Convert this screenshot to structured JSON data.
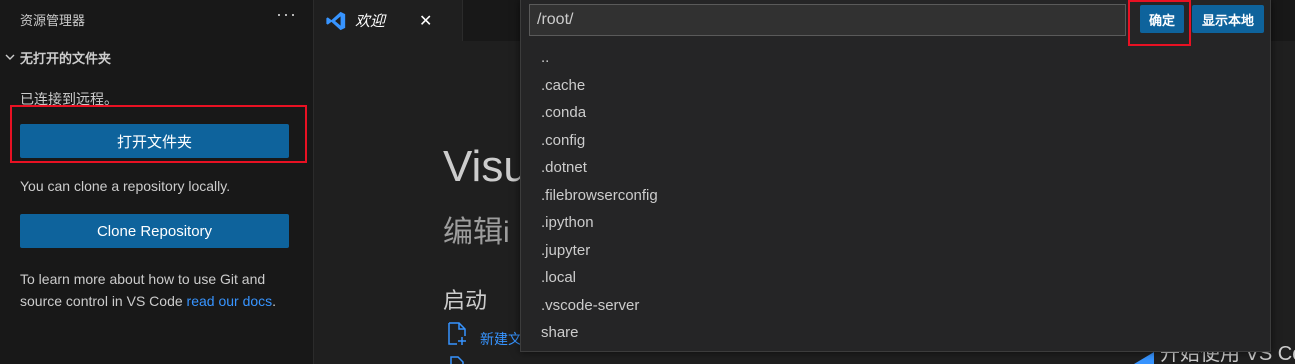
{
  "sidebar": {
    "title": "资源管理器",
    "more": "···",
    "section_title": "无打开的文件夹",
    "connected_text": "已连接到远程。",
    "open_folder_label": "打开文件夹",
    "clone_text": "You can clone a repository locally.",
    "clone_button_label": "Clone Repository",
    "learn_text": "To learn more about how to use Git and source control in VS Code ",
    "learn_link": "read our docs",
    "learn_end": "."
  },
  "tabs": [
    {
      "label": "欢迎",
      "close": "✕"
    }
  ],
  "welcome": {
    "title_partial": "Visu",
    "subtitle_partial": "编辑i",
    "start_heading": "启动",
    "new_file_partial": "新建文",
    "bottom_right_partial": "开始使用 VS Co"
  },
  "quickpick": {
    "input_value": "/root/",
    "ok_label": "确定",
    "show_local_label": "显示本地",
    "items": [
      "..",
      ".cache",
      ".conda",
      ".config",
      ".dotnet",
      ".filebrowserconfig",
      ".ipython",
      ".jupyter",
      ".local",
      ".vscode-server",
      "share"
    ]
  },
  "colors": {
    "accent": "#0e639c",
    "link": "#3794ff",
    "highlight_box": "#e81123"
  }
}
